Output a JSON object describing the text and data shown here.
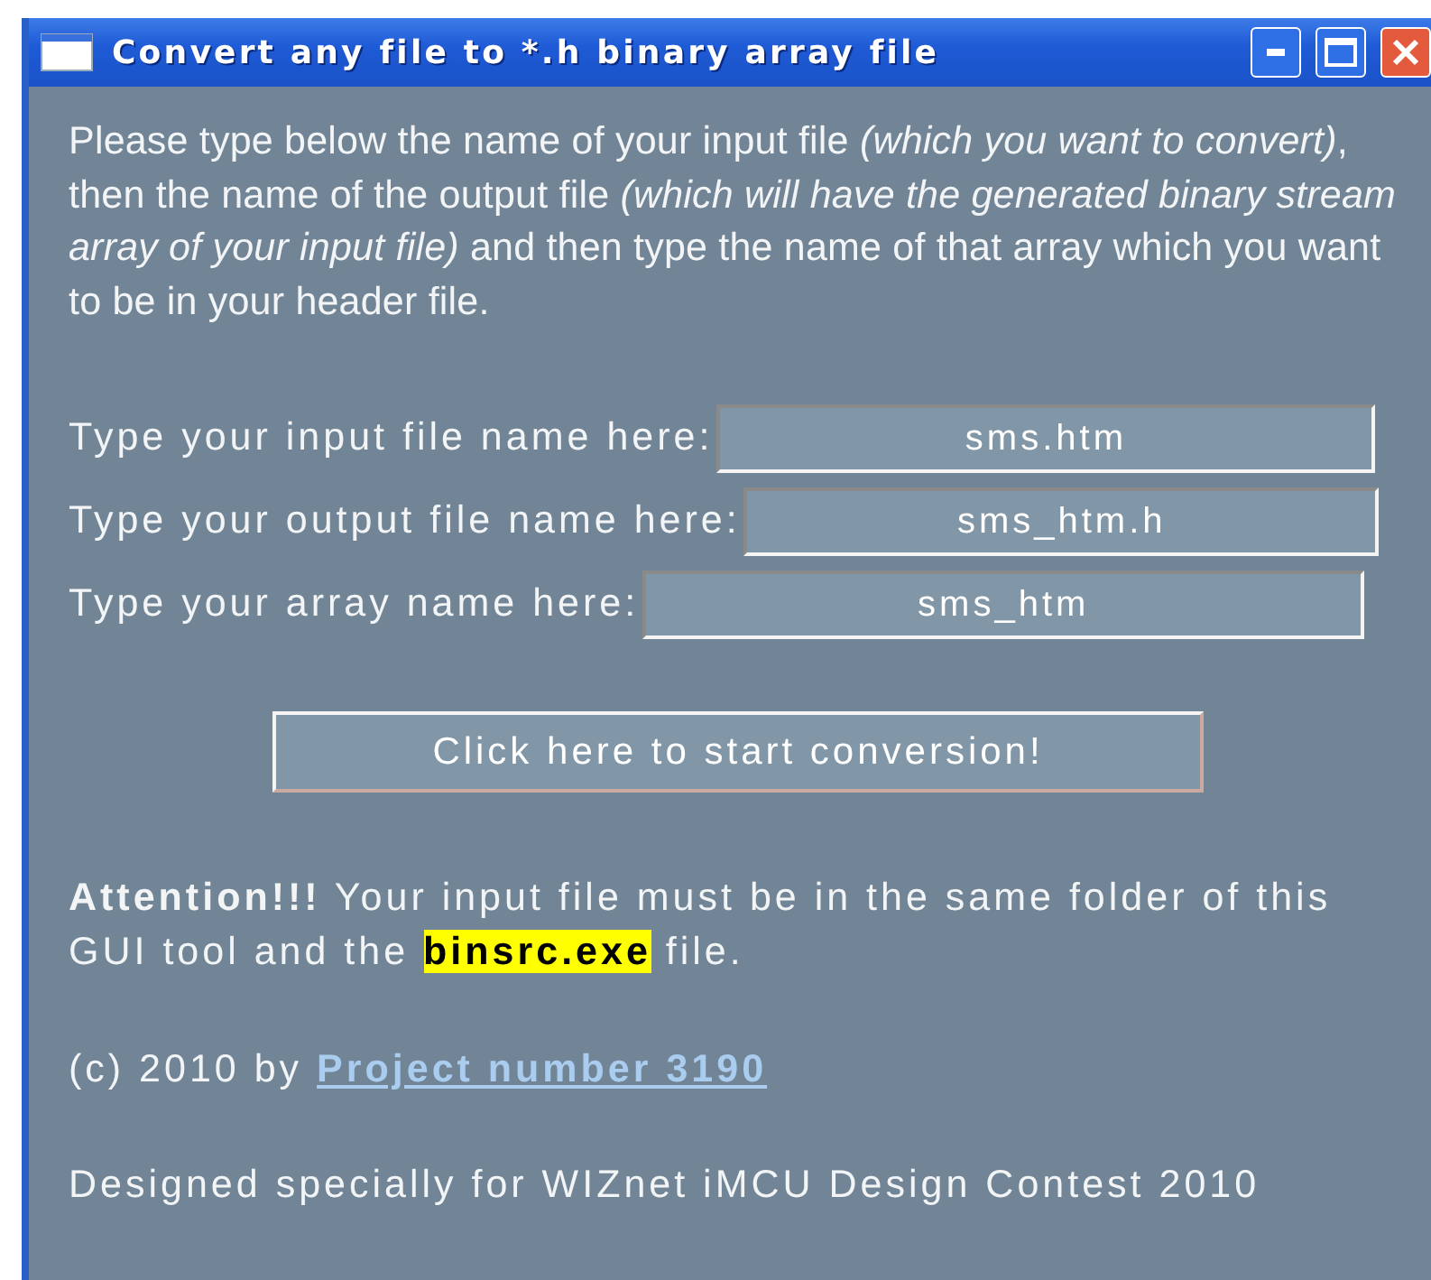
{
  "window": {
    "title": "Convert any file to *.h binary array file"
  },
  "intro": "Please type below the name of your input file *(which you want to convert)*, then the name of the output file *(which will have the generated binary stream array of your input file)* and then type the name of that array which you want to be in your header file.",
  "fields": [
    {
      "label": "Type your input file name here:",
      "value": "sms.htm"
    },
    {
      "label": "Type your output file name here:",
      "value": "sms_htm.h"
    },
    {
      "label": "Type your array name here:",
      "value": "sms_htm"
    }
  ],
  "convert_button": "Click here to start conversion!",
  "attention": [
    {
      "kind": "bold",
      "text": "Attention!!!"
    },
    {
      "kind": "plain",
      "text": " Your input file must be in the same folder of this GUI tool and the "
    },
    {
      "kind": "highlight",
      "text": "binsrc.exe"
    },
    {
      "kind": "plain",
      "text": " file."
    }
  ],
  "copyright": {
    "text": "(c) 2010 by",
    "link": "Project number 3190"
  },
  "footer": "Designed specially for WIZnet iMCU Design Contest 2010"
}
